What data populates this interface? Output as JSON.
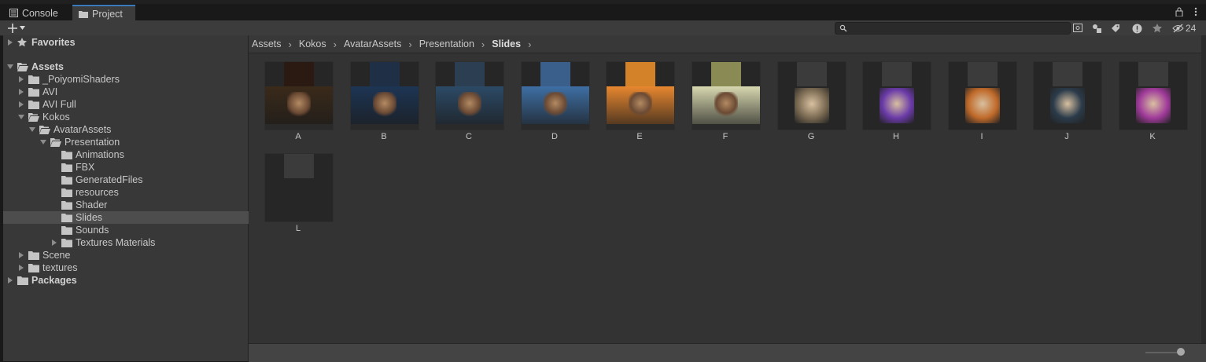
{
  "tabs": {
    "console": "Console",
    "project": "Project"
  },
  "search": {
    "value": "",
    "placeholder": ""
  },
  "toolbar": {
    "hidden_packages_count": "24"
  },
  "tree": [
    {
      "label": "Favorites",
      "bold": true,
      "depth": 0,
      "expanded": false,
      "icon": "star-icon"
    },
    {
      "label": "Assets",
      "bold": true,
      "depth": 0,
      "expanded": true,
      "icon": "folder-open-icon"
    },
    {
      "label": "_PoiyomiShaders",
      "depth": 1,
      "expanded": false,
      "icon": "folder-icon"
    },
    {
      "label": "AVI",
      "depth": 1,
      "expanded": false,
      "icon": "folder-icon"
    },
    {
      "label": "AVI Full",
      "depth": 1,
      "expanded": false,
      "icon": "folder-icon"
    },
    {
      "label": "Kokos",
      "depth": 1,
      "expanded": true,
      "icon": "folder-open-icon"
    },
    {
      "label": "AvatarAssets",
      "depth": 2,
      "expanded": true,
      "icon": "folder-open-icon"
    },
    {
      "label": "Presentation",
      "depth": 3,
      "expanded": true,
      "icon": "folder-open-icon"
    },
    {
      "label": "Animations",
      "depth": 4,
      "icon": "folder-icon"
    },
    {
      "label": "FBX",
      "depth": 4,
      "icon": "folder-icon"
    },
    {
      "label": "GeneratedFiles",
      "depth": 4,
      "icon": "folder-icon"
    },
    {
      "label": "resources",
      "depth": 4,
      "icon": "folder-icon"
    },
    {
      "label": "Shader",
      "depth": 4,
      "icon": "folder-icon"
    },
    {
      "label": "Slides",
      "depth": 4,
      "icon": "folder-icon",
      "selected": true
    },
    {
      "label": "Sounds",
      "depth": 4,
      "icon": "folder-icon"
    },
    {
      "label": "Textures Materials",
      "depth": 4,
      "expanded": false,
      "icon": "folder-icon"
    },
    {
      "label": "Scene",
      "depth": 1,
      "expanded": false,
      "icon": "folder-icon"
    },
    {
      "label": "textures",
      "depth": 1,
      "expanded": false,
      "icon": "folder-icon"
    },
    {
      "label": "Packages",
      "bold": true,
      "depth": 0,
      "expanded": false,
      "icon": "folder-icon"
    }
  ],
  "breadcrumb": [
    "Assets",
    "Kokos",
    "AvatarAssets",
    "Presentation",
    "Slides"
  ],
  "assets": [
    {
      "name": "A",
      "band": "#3a2a1a",
      "title_bg": "#2a1a12"
    },
    {
      "name": "B",
      "band": "#1d3554",
      "title_bg": "#1f2f45"
    },
    {
      "name": "C",
      "band": "#2c4a66",
      "title_bg": "#2b3e52"
    },
    {
      "name": "D",
      "band": "#3e6fa4",
      "title_bg": "#3a5f8a"
    },
    {
      "name": "E",
      "band": "#e7872f",
      "title_bg": "#d4822a"
    },
    {
      "name": "F",
      "band": "#d7d7b0",
      "title_bg": "#8a8a55"
    },
    {
      "name": "G",
      "band": "#262626",
      "title_bg": "#3b3b3b"
    },
    {
      "name": "H",
      "band": "#262626",
      "title_bg": "#3b3b3b"
    },
    {
      "name": "I",
      "band": "#262626",
      "title_bg": "#3b3b3b"
    },
    {
      "name": "J",
      "band": "#262626",
      "title_bg": "#3b3b3b"
    },
    {
      "name": "K",
      "band": "#262626",
      "title_bg": "#3b3b3b"
    },
    {
      "name": "L",
      "band": "#262626",
      "title_bg": "#3b3b3b"
    }
  ],
  "colors": {
    "accent": "#3a79bb",
    "selection": "#4d4d4d"
  }
}
